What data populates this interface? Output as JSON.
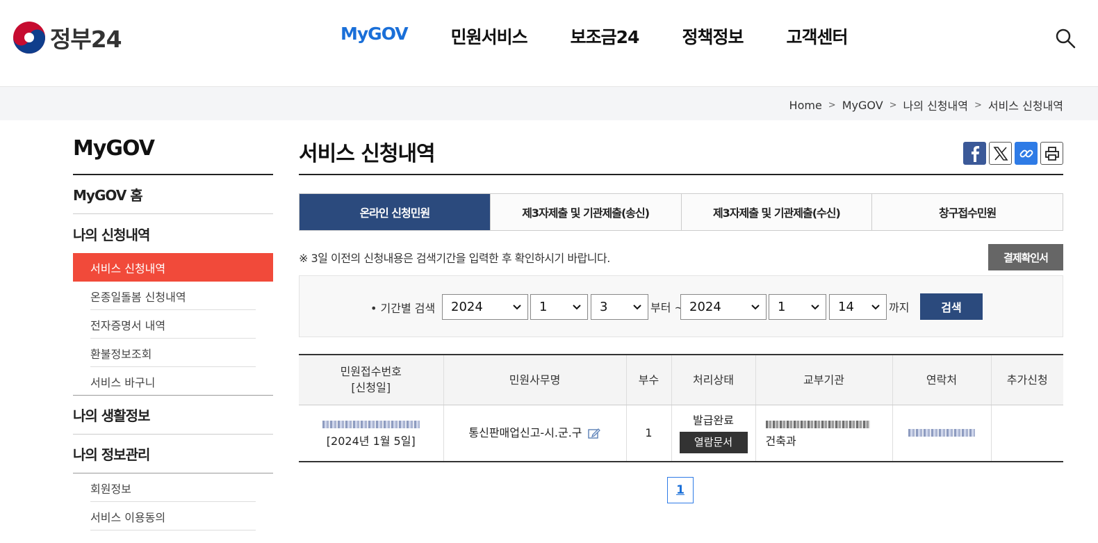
{
  "header": {
    "logo_text": "정부24",
    "nav": [
      "MyGOV",
      "민원서비스",
      "보조금24",
      "정책정보",
      "고객센터"
    ],
    "active_nav": "MyGOV"
  },
  "breadcrumb": [
    "Home",
    "MyGOV",
    "나의 신청내역",
    "서비스 신청내역"
  ],
  "sidebar": {
    "title": "MyGOV",
    "home": "MyGOV 홈",
    "section_apply": "나의 신청내역",
    "apply_items": [
      "서비스 신청내역",
      "온종일돌봄 신청내역",
      "전자증명서 내역",
      "환불정보조회",
      "서비스 바구니"
    ],
    "section_life": "나의 생활정보",
    "section_info": "나의 정보관리",
    "info_items": [
      "회원정보",
      "서비스 이용동의"
    ]
  },
  "main": {
    "title": "서비스 신청내역",
    "tabs": [
      "온라인 신청민원",
      "제3자제출 및 기관제출(송신)",
      "제3자제출 및 기관제출(수신)",
      "창구접수민원"
    ],
    "notice": "※ 3일 이전의 신청내용은 검색기간을 입력한 후 확인하시기 바랍니다.",
    "confirm_button": "결제확인서",
    "search": {
      "label": "• 기간별 검색",
      "from_year": "2024",
      "from_month": "1",
      "from_day": "3",
      "from_suffix": "부터 ~",
      "to_year": "2024",
      "to_month": "1",
      "to_day": "14",
      "to_suffix": "까지",
      "button": "검색"
    },
    "table": {
      "headers": [
        "민원접수번호",
        "[신청일]",
        "민원사무명",
        "부수",
        "처리상태",
        "교부기관",
        "연락처",
        "추가신청"
      ],
      "rows": [
        {
          "date": "[2024년 1월 5일]",
          "name": "통신판매업신고-시.군.구",
          "copies": "1",
          "status": "발급완료",
          "status_button": "열람문서",
          "agency_line2": "건축과"
        }
      ]
    },
    "pagination": [
      "1"
    ]
  },
  "colors": {
    "accent_blue": "#1a6fd8",
    "navy": "#2b4a7d",
    "sidebar_active": "#f14a3a"
  }
}
